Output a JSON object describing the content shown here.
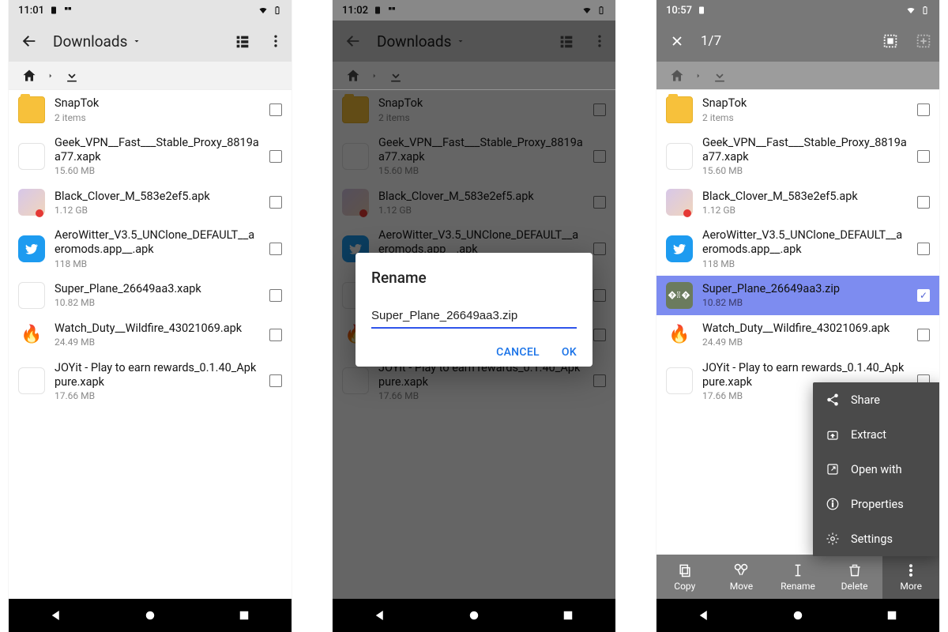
{
  "screen1": {
    "time": "11:01",
    "appbar": {
      "title": "Downloads"
    },
    "files": [
      {
        "name": "SnapTok",
        "sub": "2 items",
        "kind": "folder"
      },
      {
        "name": "Geek_VPN__Fast___Stable_Proxy_8819aa77.xapk",
        "sub": "15.60 MB",
        "kind": "blank"
      },
      {
        "name": "Black_Clover_M_583e2ef5.apk",
        "sub": "1.12 GB",
        "kind": "anime"
      },
      {
        "name": "AeroWitter_V3.5_UNClone_DEFAULT__aeromods.app__.apk",
        "sub": "118 MB",
        "kind": "twitter"
      },
      {
        "name": "Super_Plane_26649aa3.xapk",
        "sub": "10.82 MB",
        "kind": "blank"
      },
      {
        "name": "Watch_Duty__Wildfire_43021069.apk",
        "sub": "24.49 MB",
        "kind": "fire"
      },
      {
        "name": "JOYit - Play to earn rewards_0.1.40_Apkpure.xapk",
        "sub": "17.66 MB",
        "kind": "blank"
      }
    ]
  },
  "screen2": {
    "time": "11:02",
    "appbar": {
      "title": "Downloads"
    },
    "dialog": {
      "title": "Rename",
      "value": "Super_Plane_26649aa3.zip",
      "cancel": "CANCEL",
      "ok": "OK"
    }
  },
  "screen3": {
    "time": "10:57",
    "selection_counter": "1/7",
    "files": [
      {
        "name": "SnapTok",
        "sub": "2 items",
        "kind": "folder",
        "selected": false
      },
      {
        "name": "Geek_VPN__Fast___Stable_Proxy_8819aa77.xapk",
        "sub": "15.60 MB",
        "kind": "blank",
        "selected": false
      },
      {
        "name": "Black_Clover_M_583e2ef5.apk",
        "sub": "1.12 GB",
        "kind": "anime",
        "selected": false
      },
      {
        "name": "AeroWitter_V3.5_UNClone_DEFAULT__aeromods.app__.apk",
        "sub": "118 MB",
        "kind": "twitter",
        "selected": false
      },
      {
        "name": "Super_Plane_26649aa3.zip",
        "sub": "10.82 MB",
        "kind": "zip",
        "selected": true
      },
      {
        "name": "Watch_Duty__Wildfire_43021069.apk",
        "sub": "24.49 MB",
        "kind": "fire",
        "selected": false
      },
      {
        "name": "JOYit - Play to earn rewards_0.1.40_Apkpure.xapk",
        "sub": "17.66 MB",
        "kind": "blank",
        "selected": false
      }
    ],
    "popup": {
      "share": "Share",
      "extract": "Extract",
      "open_with": "Open with",
      "properties": "Properties",
      "settings": "Settings"
    },
    "bottombar": {
      "copy": "Copy",
      "move": "Move",
      "rename": "Rename",
      "delete": "Delete",
      "more": "More"
    }
  }
}
